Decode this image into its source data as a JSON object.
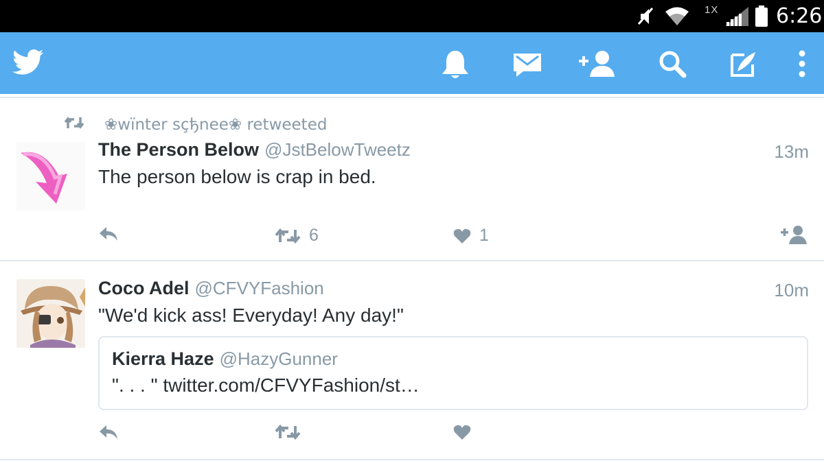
{
  "status_bar": {
    "network_type": "1X",
    "time": "6:26"
  },
  "app_bar": {
    "brand_color": "#55acee",
    "icons": [
      "twitter-bird-icon",
      "notifications-bell-icon",
      "messages-envelope-icon",
      "add-user-icon",
      "search-icon",
      "compose-tweet-icon",
      "more-vertical-icon"
    ]
  },
  "tweets": [
    {
      "retweet_context": "❀wïnter sçђnee❀",
      "retweet_label": "retweeted",
      "name": "The Person Below",
      "handle": "@JstBelowTweetz",
      "time": "13m",
      "text": "The person below is crap in bed.",
      "retweet_count": "6",
      "like_count": "1"
    },
    {
      "name": "Coco Adel",
      "handle": "@CFVYFashion",
      "time": "10m",
      "text": "\"We'd kick ass! Everyday! Any day!\"",
      "quoted": {
        "name": "Kierra Haze",
        "handle": "@HazyGunner",
        "text": "\". . . \" twitter.com/CFVYFashion/st…"
      }
    }
  ]
}
